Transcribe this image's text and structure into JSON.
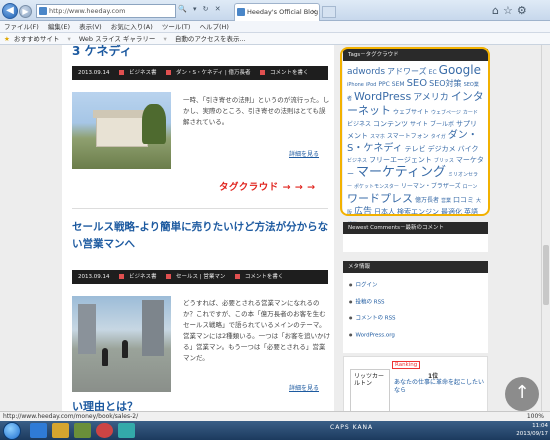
{
  "browser": {
    "url": "http://www.heeday.com",
    "tab_title": "Heeday's Official Blog | ...",
    "zoom": "100%",
    "status_url": "http://www.heeday.com/money/book/sales-2/",
    "menu": [
      "ファイル(F)",
      "編集(E)",
      "表示(V)",
      "お気に入り(A)",
      "ツール(T)",
      "ヘルプ(H)"
    ],
    "favorites": [
      "おすすめサイト",
      "Web スライス ギャラリー"
    ],
    "fav_third": "自動のアクセスを表示..."
  },
  "post1": {
    "title_fragment": "3 ケネディ",
    "date": "2013.09.14",
    "category": "ビジネス書",
    "tags": "ダン・S・ケネディ | 億万長者",
    "comment": "コメントを書く",
    "excerpt": "一時、「引き寄せの法則」というのが流行った。しかし、実際のところ、引き寄せの法則はとても誤解されている。",
    "more": "詳細を見る"
  },
  "annotation": "タグクラウド → → →",
  "post2": {
    "title": "セールス戦略-より簡単に売りたいけど方法が分からない営業マンへ",
    "date": "2013.09.14",
    "category": "ビジネス書",
    "tags": "セールス | 営業マン",
    "comment": "コメントを書く",
    "excerpt": "どうすれば、必要とされる営業マンになれるのか？これですが、この本「億万長者のお客を生むセールス戦略」で語られているメインのテーマ。営業マンには2種類いる。一つは「お客を追いかける」営業マン。もう一つは「必要とされる」営業マンだ。",
    "more": "詳細を見る"
  },
  "post3": {
    "title_fragment": "い理由とは？"
  },
  "sidebar": {
    "tags_heading": "Tags－タグクラウド",
    "tags": [
      {
        "t": "adwords",
        "s": 9
      },
      {
        "t": "アドワーズ",
        "s": 8
      },
      {
        "t": "EC",
        "s": 6
      },
      {
        "t": "Google",
        "s": 12
      },
      {
        "t": "iPhone",
        "s": 5
      },
      {
        "t": "iPod",
        "s": 5
      },
      {
        "t": "PPC",
        "s": 6
      },
      {
        "t": "SEM",
        "s": 6
      },
      {
        "t": "SEO",
        "s": 10
      },
      {
        "t": "SEO対策",
        "s": 8
      },
      {
        "t": "SEO業者",
        "s": 5
      },
      {
        "t": "WordPress",
        "s": 11
      },
      {
        "t": "アメリカ",
        "s": 9
      },
      {
        "t": "インターネット",
        "s": 11
      },
      {
        "t": "ウェブサイト",
        "s": 6
      },
      {
        "t": "ウェブページ",
        "s": 5
      },
      {
        "t": "カード",
        "s": 5
      },
      {
        "t": "ビジネス",
        "s": 6
      },
      {
        "t": "コンテンツ",
        "s": 7
      },
      {
        "t": "サイト",
        "s": 6
      },
      {
        "t": "ブールボ",
        "s": 6
      },
      {
        "t": "サプリメント",
        "s": 7
      },
      {
        "t": "スマホ",
        "s": 5
      },
      {
        "t": "スマートフォン",
        "s": 6
      },
      {
        "t": "タイガ",
        "s": 5
      },
      {
        "t": "ダン・S・ケネディ",
        "s": 10
      },
      {
        "t": "テレビ",
        "s": 7
      },
      {
        "t": "デジカメ",
        "s": 7
      },
      {
        "t": "バイク",
        "s": 7
      },
      {
        "t": "ビジネス",
        "s": 5
      },
      {
        "t": "フリーエージェント",
        "s": 7
      },
      {
        "t": "ブリッス",
        "s": 5
      },
      {
        "t": "マーケター",
        "s": 7
      },
      {
        "t": "マーケティング",
        "s": 13
      },
      {
        "t": "ミリオンセラー",
        "s": 5
      },
      {
        "t": "ポケットモンスター",
        "s": 5
      },
      {
        "t": "リーマン・ブラザーズ",
        "s": 6
      },
      {
        "t": "ローン",
        "s": 5
      },
      {
        "t": "ワードプレス",
        "s": 11
      },
      {
        "t": "億万長者",
        "s": 6
      },
      {
        "t": "営業",
        "s": 5
      },
      {
        "t": "口コミ",
        "s": 7
      },
      {
        "t": "大阪",
        "s": 5
      },
      {
        "t": "広告",
        "s": 9
      },
      {
        "t": "日本人",
        "s": 7
      },
      {
        "t": "検索エンジン",
        "s": 7
      },
      {
        "t": "最適化",
        "s": 7
      },
      {
        "t": "英語",
        "s": 7
      },
      {
        "t": "起業",
        "s": 5
      }
    ],
    "newest_heading": "Newest Comments－最新のコメント",
    "meta_heading": "メタ情報",
    "meta_links": [
      "ログイン",
      "投稿の RSS",
      "コメントの RSS",
      "WordPress.org"
    ],
    "ad_rank": "Ranking",
    "ad_rank_no": "1位",
    "ad_text": "あなたの仕事に革命を起こしたいなら",
    "ad_book": "リッツカールトン"
  },
  "taskbar": {
    "time": "11:04",
    "date": "2013/09/17",
    "tray": "CAPS KANA"
  }
}
